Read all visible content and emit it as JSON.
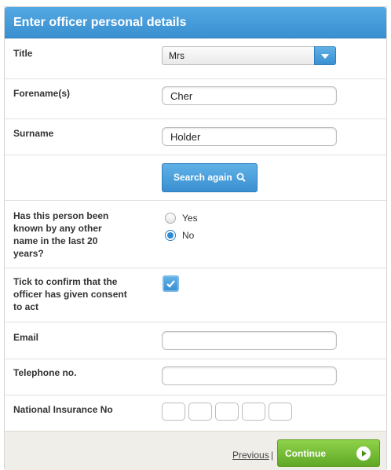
{
  "header": {
    "title": "Enter officer personal details"
  },
  "fields": {
    "title": {
      "label": "Title",
      "value": "Mrs"
    },
    "forename": {
      "label": "Forename(s)",
      "value": "Cher"
    },
    "surname": {
      "label": "Surname",
      "value": "Holder"
    },
    "search_button": "Search again",
    "known_other_name": {
      "label": "Has this person been known by any other name in the last 20 years?",
      "options": [
        "Yes",
        "No"
      ],
      "selected": "No"
    },
    "consent": {
      "label": "Tick to confirm that the officer has given consent to act",
      "checked": true
    },
    "email": {
      "label": "Email",
      "value": ""
    },
    "telephone": {
      "label": "Telephone no.",
      "value": ""
    },
    "ni": {
      "label": "National Insurance No",
      "boxes": [
        "",
        "",
        "",
        "",
        ""
      ]
    }
  },
  "footer": {
    "previous": "Previous",
    "separator": "|",
    "continue": "Continue"
  },
  "colors": {
    "accent_blue": "#3a8fd0",
    "continue_green": "#6bb52e"
  },
  "icons": {
    "search": "search-icon",
    "dropdown": "chevron-down-icon",
    "checkmark": "checkmark-icon",
    "continue": "arrow-right-circle-icon"
  }
}
